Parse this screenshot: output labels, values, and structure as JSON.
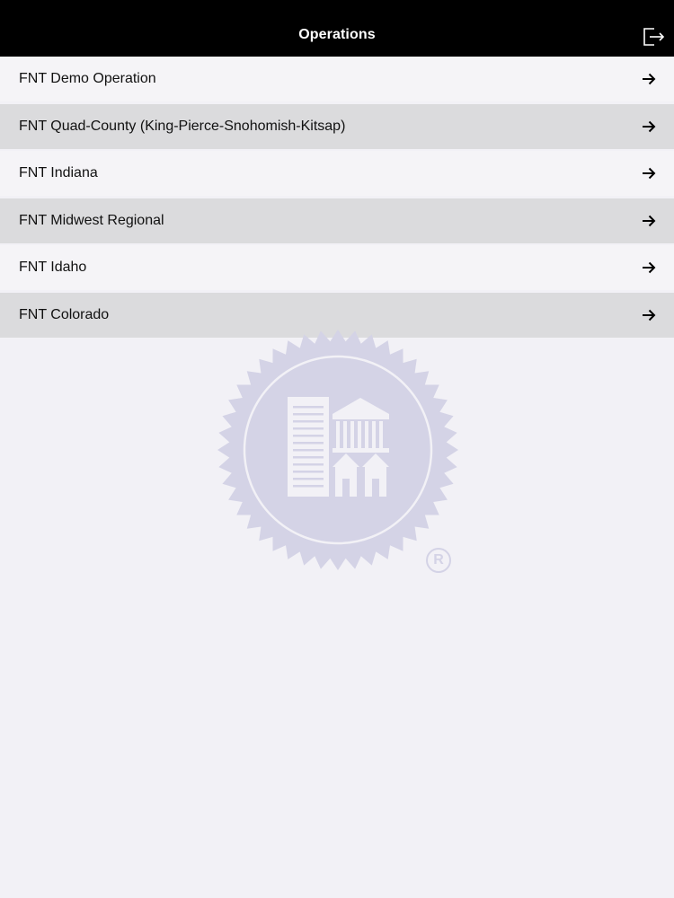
{
  "header": {
    "title": "Operations"
  },
  "operations": [
    {
      "label": "FNT Demo Operation"
    },
    {
      "label": "FNT Quad-County (King-Pierce-Snohomish-Kitsap)"
    },
    {
      "label": "FNT Indiana"
    },
    {
      "label": "FNT Midwest Regional"
    },
    {
      "label": "FNT Idaho"
    },
    {
      "label": "FNT Colorado"
    }
  ],
  "watermark": {
    "registered_mark": "R"
  },
  "colors": {
    "navbar_bg": "#000000",
    "row_light": "#f5f4f7",
    "row_dark": "#dbdbdd",
    "background": "#f2f1f6",
    "watermark": "#d4d3e6"
  },
  "icons": {
    "logout": "logout-icon",
    "row_arrow": "arrow-right-icon",
    "watermark": "seal-logo-icon"
  }
}
